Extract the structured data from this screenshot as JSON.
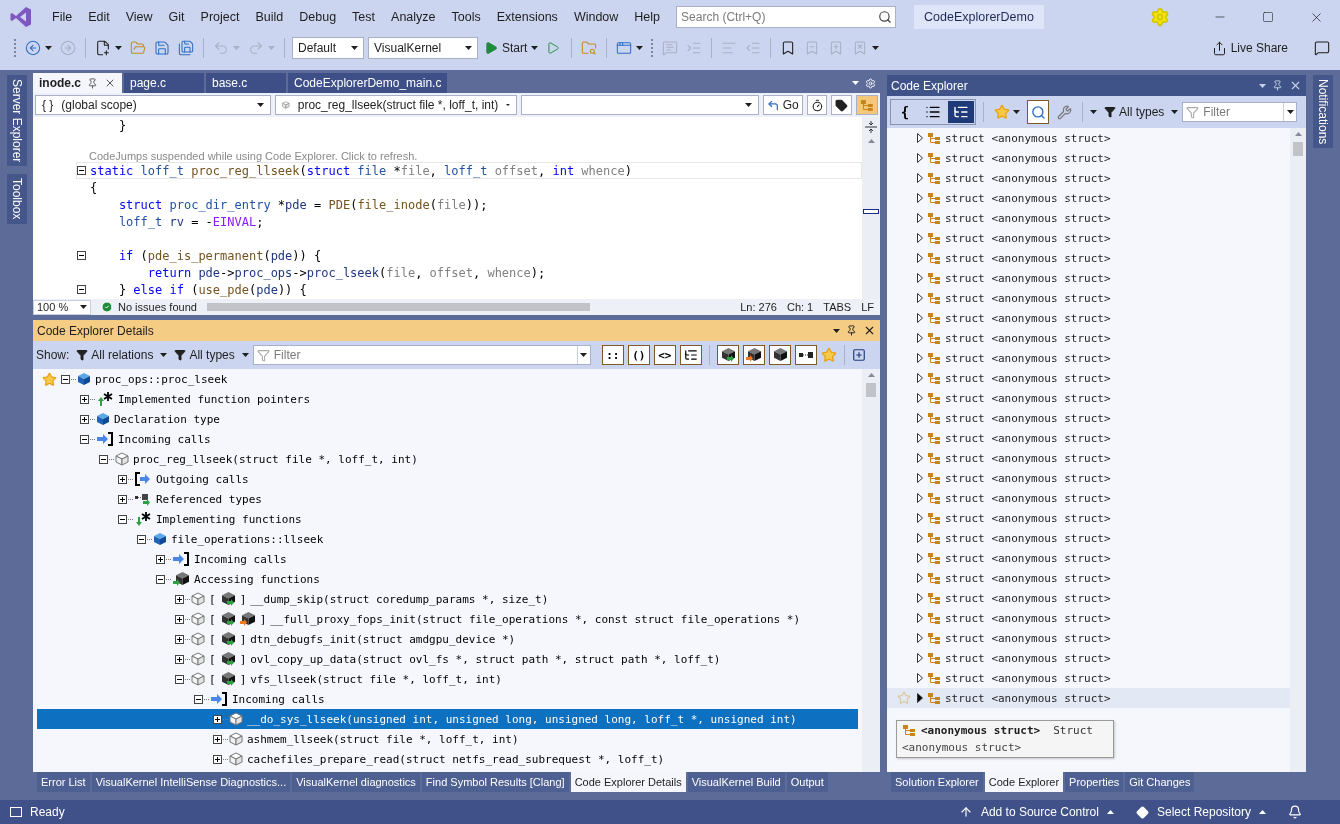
{
  "title_bar": {
    "menu": [
      "File",
      "Edit",
      "View",
      "Git",
      "Project",
      "Build",
      "Debug",
      "Test",
      "Analyze",
      "Tools",
      "Extensions",
      "Window",
      "Help"
    ],
    "search": {
      "placeholder": "Search (Ctrl+Q)"
    },
    "solution_name": "CodeExplorerDemo"
  },
  "toolbar": {
    "configuration": "Default",
    "platform": "VisualKernel",
    "start": "Start",
    "live_share": "Live Share"
  },
  "side_tabs_left": [
    "Server Explorer",
    "Toolbox"
  ],
  "side_tabs_right": [
    "Notifications"
  ],
  "editor": {
    "tabs": [
      {
        "label": "inode.c",
        "selected": true
      },
      {
        "label": "page.c",
        "selected": false
      },
      {
        "label": "base.c",
        "selected": false
      },
      {
        "label": "CodeExplorerDemo_main.c",
        "selected": false
      }
    ],
    "scope_glyph": "{ }",
    "scope": "(global scope)",
    "function": "proc_reg_llseek(struct file *, loff_t, int)",
    "go": "Go",
    "codejumps_on": true,
    "lines": [
      {
        "kind": "code",
        "current": false,
        "fold": false,
        "tokens": [
          {
            "kind": "plain",
            "text": "    }"
          }
        ]
      },
      {
        "kind": "code",
        "current": true,
        "fold": true,
        "lens": "CodeJumps suspended while using Code Explorer. Click to refresh.",
        "tokens": [
          {
            "kind": "keyword",
            "text": "static "
          },
          {
            "kind": "type",
            "text": "loff_t "
          },
          {
            "kind": "function",
            "text": "proc_reg_llseek"
          },
          {
            "kind": "plain",
            "text": "("
          },
          {
            "kind": "keyword",
            "text": "struct "
          },
          {
            "kind": "type",
            "text": "file "
          },
          {
            "kind": "plain",
            "text": "*"
          },
          {
            "kind": "param",
            "text": "file"
          },
          {
            "kind": "plain",
            "text": ", "
          },
          {
            "kind": "type",
            "text": "loff_t "
          },
          {
            "kind": "param",
            "text": "offset"
          },
          {
            "kind": "plain",
            "text": ", "
          },
          {
            "kind": "keyword",
            "text": "int "
          },
          {
            "kind": "param",
            "text": "whence"
          },
          {
            "kind": "plain",
            "text": ")"
          }
        ]
      },
      {
        "kind": "code",
        "current": false,
        "fold": false,
        "tokens": [
          {
            "kind": "plain",
            "text": "{"
          }
        ]
      },
      {
        "kind": "code",
        "current": false,
        "fold": false,
        "tokens": [
          {
            "kind": "keyword",
            "text": "    struct "
          },
          {
            "kind": "type",
            "text": "proc_dir_entry "
          },
          {
            "kind": "plain",
            "text": "*"
          },
          {
            "kind": "local",
            "text": "pde"
          },
          {
            "kind": "plain",
            "text": " = "
          },
          {
            "kind": "function",
            "text": "PDE"
          },
          {
            "kind": "plain",
            "text": "("
          },
          {
            "kind": "function",
            "text": "file_inode"
          },
          {
            "kind": "plain",
            "text": "("
          },
          {
            "kind": "param",
            "text": "file"
          },
          {
            "kind": "plain",
            "text": "));"
          }
        ]
      },
      {
        "kind": "code",
        "current": false,
        "fold": false,
        "tokens": [
          {
            "kind": "type",
            "text": "    loff_t "
          },
          {
            "kind": "local",
            "text": "rv"
          },
          {
            "kind": "plain",
            "text": " = -"
          },
          {
            "kind": "macro",
            "text": "EINVAL"
          },
          {
            "kind": "plain",
            "text": ";"
          }
        ]
      },
      {
        "kind": "blank"
      },
      {
        "kind": "code",
        "current": false,
        "fold": true,
        "tokens": [
          {
            "kind": "keyword",
            "text": "    if "
          },
          {
            "kind": "plain",
            "text": "("
          },
          {
            "kind": "function",
            "text": "pde_is_permanent"
          },
          {
            "kind": "plain",
            "text": "("
          },
          {
            "kind": "local",
            "text": "pde"
          },
          {
            "kind": "plain",
            "text": ")) {"
          }
        ]
      },
      {
        "kind": "code",
        "current": false,
        "fold": false,
        "tokens": [
          {
            "kind": "keyword",
            "text": "        return "
          },
          {
            "kind": "local",
            "text": "pde"
          },
          {
            "kind": "plain",
            "text": "->"
          },
          {
            "kind": "local",
            "text": "proc_ops"
          },
          {
            "kind": "plain",
            "text": "->"
          },
          {
            "kind": "local",
            "text": "proc_lseek"
          },
          {
            "kind": "plain",
            "text": "("
          },
          {
            "kind": "param",
            "text": "file"
          },
          {
            "kind": "plain",
            "text": ", "
          },
          {
            "kind": "param",
            "text": "offset"
          },
          {
            "kind": "plain",
            "text": ", "
          },
          {
            "kind": "param",
            "text": "whence"
          },
          {
            "kind": "plain",
            "text": ");"
          }
        ]
      },
      {
        "kind": "code",
        "current": false,
        "fold": true,
        "tokens": [
          {
            "kind": "plain",
            "text": "    } "
          },
          {
            "kind": "keyword",
            "text": "else if "
          },
          {
            "kind": "plain",
            "text": "("
          },
          {
            "kind": "function",
            "text": "use_pde"
          },
          {
            "kind": "plain",
            "text": "("
          },
          {
            "kind": "local",
            "text": "pde"
          },
          {
            "kind": "plain",
            "text": ")) {"
          }
        ]
      }
    ],
    "zoom": "100 %",
    "issues": "No issues found",
    "ln": "Ln: 276",
    "ch": "Ch: 1",
    "indent": "TABS",
    "eol": "LF"
  },
  "details": {
    "title": "Code Explorer Details",
    "show_label": "Show:",
    "relations": "All relations",
    "types": "All types",
    "filter": {
      "placeholder": "Filter"
    },
    "toggles": [
      {
        "label": "::",
        "on": true
      },
      {
        "label": "()",
        "on": true
      },
      {
        "label": "<>",
        "on": true
      },
      {
        "kind": "tree",
        "on": true
      }
    ],
    "access_filters": [
      {
        "kind": "read",
        "on": true
      },
      {
        "kind": "write",
        "on": true
      },
      {
        "kind": "plain",
        "on": true
      },
      {
        "kind": "members",
        "on": true
      }
    ],
    "tree": [
      {
        "label": "proc_ops::proc_lseek",
        "kind": "field",
        "starred": true,
        "expanded": true,
        "selected": false,
        "children": [
          {
            "label": "Implemented function pointers",
            "kind": "impl-up",
            "expanded": false,
            "selected": false
          },
          {
            "label": "Declaration type",
            "kind": "field",
            "expanded": false,
            "selected": false
          },
          {
            "label": "Incoming calls",
            "kind": "incoming",
            "expanded": true,
            "selected": false,
            "children": [
              {
                "label": "proc_reg_llseek(struct file *, loff_t, int)",
                "kind": "function",
                "expanded": true,
                "selected": false,
                "children": [
                  {
                    "label": "Outgoing calls",
                    "kind": "outgoing",
                    "expanded": false,
                    "selected": false
                  },
                  {
                    "label": "Referenced types",
                    "kind": "reftypes",
                    "expanded": false,
                    "selected": false
                  },
                  {
                    "label": "Implementing functions",
                    "kind": "impl-down",
                    "expanded": true,
                    "selected": false,
                    "children": [
                      {
                        "label": "file_operations::llseek",
                        "kind": "field",
                        "expanded": true,
                        "selected": false,
                        "children": [
                          {
                            "label": "Incoming calls",
                            "kind": "incoming",
                            "expanded": false,
                            "selected": false
                          },
                          {
                            "label": "Accessing functions",
                            "kind": "access",
                            "expanded": true,
                            "selected": false,
                            "children": [
                              {
                                "label": "__dump_skip(struct coredump_params *, size_t)",
                                "kind": "function",
                                "bracket_open": "[",
                                "access": [
                                  {
                                    "kind": "read"
                                  }
                                ],
                                "bracket_close": "]",
                                "expanded": false,
                                "selected": false
                              },
                              {
                                "label": "__full_proxy_fops_init(struct file_operations *, const struct file_operations *)",
                                "kind": "function",
                                "bracket_open": "[",
                                "access": [
                                  {
                                    "kind": "read"
                                  },
                                  {
                                    "kind": "write"
                                  }
                                ],
                                "bracket_close": "]",
                                "expanded": false,
                                "selected": false
                              },
                              {
                                "label": "dtn_debugfs_init(struct amdgpu_device *)",
                                "kind": "function",
                                "bracket_open": "[",
                                "access": [
                                  {
                                    "kind": "read"
                                  }
                                ],
                                "bracket_close": "]",
                                "expanded": false,
                                "selected": false
                              },
                              {
                                "label": "ovl_copy_up_data(struct ovl_fs *, struct path *, struct path *, loff_t)",
                                "kind": "function",
                                "bracket_open": "[",
                                "access": [
                                  {
                                    "kind": "read"
                                  }
                                ],
                                "bracket_close": "]",
                                "expanded": false,
                                "selected": false
                              },
                              {
                                "label": "vfs_llseek(struct file *, loff_t, int)",
                                "kind": "function",
                                "bracket_open": "[",
                                "access": [
                                  {
                                    "kind": "read"
                                  }
                                ],
                                "bracket_close": "]",
                                "expanded": true,
                                "selected": false,
                                "children": [
                                  {
                                    "label": "Incoming calls",
                                    "kind": "incoming",
                                    "expanded": true,
                                    "selected": false,
                                    "children": [
                                      {
                                        "label": "__do_sys_llseek(unsigned int, unsigned long, unsigned long, loff_t *, unsigned int)",
                                        "kind": "function",
                                        "expanded": false,
                                        "selected": true
                                      },
                                      {
                                        "label": "ashmem_llseek(struct file *, loff_t, int)",
                                        "kind": "function",
                                        "expanded": false,
                                        "selected": false
                                      },
                                      {
                                        "label": "cachefiles_prepare_read(struct netfs_read_subrequest *, loff_t)",
                                        "kind": "function",
                                        "expanded": false,
                                        "selected": false
                                      }
                                    ]
                                  }
                                ]
                              }
                            ]
                          }
                        ]
                      }
                    ]
                  }
                ]
              }
            ]
          }
        ]
      }
    ]
  },
  "code_explorer": {
    "title": "Code Explorer",
    "view_modes": [
      {
        "kind": "braces",
        "label": "{",
        "selected": false
      },
      {
        "kind": "list",
        "selected": false
      },
      {
        "kind": "tree",
        "selected": true
      }
    ],
    "search_active": true,
    "types": "All types",
    "filter": {
      "placeholder": "Filter"
    },
    "rows": [
      {
        "keyword": "struct",
        "name": "<anonymous struct>",
        "hovered": false
      },
      {
        "keyword": "struct",
        "name": "<anonymous struct>",
        "hovered": false
      },
      {
        "keyword": "struct",
        "name": "<anonymous struct>",
        "hovered": false
      },
      {
        "keyword": "struct",
        "name": "<anonymous struct>",
        "hovered": false
      },
      {
        "keyword": "struct",
        "name": "<anonymous struct>",
        "hovered": false
      },
      {
        "keyword": "struct",
        "name": "<anonymous struct>",
        "hovered": false
      },
      {
        "keyword": "struct",
        "name": "<anonymous struct>",
        "hovered": false
      },
      {
        "keyword": "struct",
        "name": "<anonymous struct>",
        "hovered": false
      },
      {
        "keyword": "struct",
        "name": "<anonymous struct>",
        "hovered": false
      },
      {
        "keyword": "struct",
        "name": "<anonymous struct>",
        "hovered": false
      },
      {
        "keyword": "struct",
        "name": "<anonymous struct>",
        "hovered": false
      },
      {
        "keyword": "struct",
        "name": "<anonymous struct>",
        "hovered": false
      },
      {
        "keyword": "struct",
        "name": "<anonymous struct>",
        "hovered": false
      },
      {
        "keyword": "struct",
        "name": "<anonymous struct>",
        "hovered": false
      },
      {
        "keyword": "struct",
        "name": "<anonymous struct>",
        "hovered": false
      },
      {
        "keyword": "struct",
        "name": "<anonymous struct>",
        "hovered": false
      },
      {
        "keyword": "struct",
        "name": "<anonymous struct>",
        "hovered": false
      },
      {
        "keyword": "struct",
        "name": "<anonymous struct>",
        "hovered": false
      },
      {
        "keyword": "struct",
        "name": "<anonymous struct>",
        "hovered": false
      },
      {
        "keyword": "struct",
        "name": "<anonymous struct>",
        "hovered": false
      },
      {
        "keyword": "struct",
        "name": "<anonymous struct>",
        "hovered": false
      },
      {
        "keyword": "struct",
        "name": "<anonymous struct>",
        "hovered": false
      },
      {
        "keyword": "struct",
        "name": "<anonymous struct>",
        "hovered": false
      },
      {
        "keyword": "struct",
        "name": "<anonymous struct>",
        "hovered": false
      },
      {
        "keyword": "struct",
        "name": "<anonymous struct>",
        "hovered": false
      },
      {
        "keyword": "struct",
        "name": "<anonymous struct>",
        "hovered": false
      },
      {
        "keyword": "struct",
        "name": "<anonymous struct>",
        "hovered": false
      },
      {
        "keyword": "struct",
        "name": "<anonymous struct>",
        "hovered": false
      },
      {
        "keyword": "struct",
        "name": "<anonymous struct>",
        "hovered": true
      }
    ],
    "tooltip": {
      "name": "<anonymous struct>",
      "kind": "Struct",
      "detail": "<anonymous struct>"
    }
  },
  "bottom_tabs": [
    {
      "label": "Error List",
      "selected": false
    },
    {
      "label": "VisualKernel IntelliSense Diagnostics...",
      "selected": false
    },
    {
      "label": "VisualKernel diagnostics",
      "selected": false
    },
    {
      "label": "Find Symbol Results [Clang]",
      "selected": false
    },
    {
      "label": "Code Explorer Details",
      "selected": true
    },
    {
      "label": "VisualKernel Build",
      "selected": false
    },
    {
      "label": "Output",
      "selected": false
    }
  ],
  "right_tabs": [
    {
      "label": "Solution Explorer",
      "selected": false
    },
    {
      "label": "Code Explorer",
      "selected": true
    },
    {
      "label": "Properties",
      "selected": false
    },
    {
      "label": "Git Changes",
      "selected": false
    }
  ],
  "status_bar": {
    "ready": "Ready",
    "source_control": "Add to Source Control",
    "repository": "Select Repository"
  }
}
